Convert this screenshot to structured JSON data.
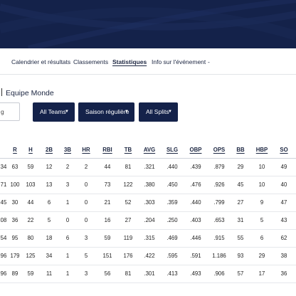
{
  "subnav": {
    "items": [
      {
        "label": "Calendrier et résultats",
        "active": false
      },
      {
        "label": "Classements",
        "active": false
      },
      {
        "label": "Statistiques",
        "active": true
      },
      {
        "label": "Info sur l'événement",
        "active": false
      },
      {
        "label": "-",
        "active": false
      }
    ]
  },
  "heading": {
    "text": "Equipe Monde"
  },
  "search": {
    "value": "g"
  },
  "filters": {
    "teams": "All Teams",
    "season": "Saison régulière",
    "splits": "All Splits"
  },
  "colors": {
    "navy": "#14224a"
  },
  "table": {
    "headers": [
      "",
      "R",
      "H",
      "2B",
      "3B",
      "HR",
      "RBI",
      "TB",
      "AVG",
      "SLG",
      "OBP",
      "OPS",
      "BB",
      "HBP",
      "SO"
    ],
    "rows": [
      [
        "34",
        "63",
        "59",
        "12",
        "2",
        "2",
        "44",
        "81",
        ".321",
        ".440",
        ".439",
        ".879",
        "29",
        "10",
        "49"
      ],
      [
        "71",
        "100",
        "103",
        "13",
        "3",
        "0",
        "73",
        "122",
        ".380",
        ".450",
        ".476",
        ".926",
        "45",
        "10",
        "40"
      ],
      [
        "45",
        "30",
        "44",
        "6",
        "1",
        "0",
        "21",
        "52",
        ".303",
        ".359",
        ".440",
        ".799",
        "27",
        "9",
        "47"
      ],
      [
        "08",
        "36",
        "22",
        "5",
        "0",
        "0",
        "16",
        "27",
        ".204",
        ".250",
        ".403",
        ".653",
        "31",
        "5",
        "43"
      ],
      [
        "54",
        "95",
        "80",
        "18",
        "6",
        "3",
        "59",
        "119",
        ".315",
        ".469",
        ".446",
        ".915",
        "55",
        "6",
        "62"
      ],
      [
        "96",
        "179",
        "125",
        "34",
        "1",
        "5",
        "151",
        "176",
        ".422",
        ".595",
        ".591",
        "1.186",
        "93",
        "29",
        "38"
      ],
      [
        "96",
        "89",
        "59",
        "11",
        "1",
        "3",
        "56",
        "81",
        ".301",
        ".413",
        ".493",
        ".906",
        "57",
        "17",
        "36"
      ]
    ]
  }
}
